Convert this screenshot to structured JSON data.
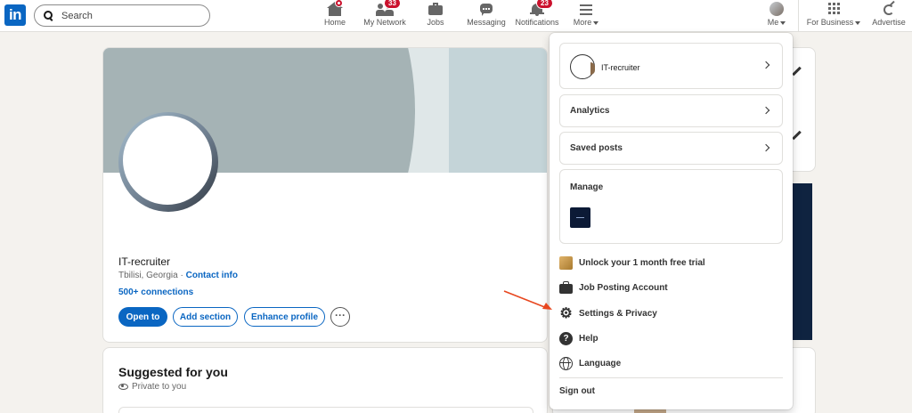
{
  "nav": {
    "logo": "in",
    "search_placeholder": "Search",
    "items": [
      {
        "label": "Home",
        "icon": "home-icon"
      },
      {
        "label": "My Network",
        "icon": "network-icon",
        "badge": "33"
      },
      {
        "label": "Jobs",
        "icon": "jobs-icon"
      },
      {
        "label": "Messaging",
        "icon": "messaging-icon"
      },
      {
        "label": "Notifications",
        "icon": "bell-icon",
        "badge": "23"
      },
      {
        "label": "More",
        "icon": "menu-icon"
      },
      {
        "label": "Me",
        "icon": "avatar"
      },
      {
        "label": "For Business",
        "icon": "grid-icon"
      },
      {
        "label": "Advertise",
        "icon": "advertise-icon"
      }
    ]
  },
  "profile": {
    "name": "IT-recruiter",
    "location": "Tbilisi, Georgia",
    "separator": "·",
    "contact_info": "Contact info",
    "connections": "500+ connections",
    "buttons": {
      "open_to": "Open to",
      "add_section": "Add section",
      "enhance_profile": "Enhance profile",
      "more": "···"
    }
  },
  "suggested": {
    "title": "Suggested for you",
    "privacy": "Private to you"
  },
  "dropdown": {
    "profile_name": "IT-recruiter",
    "analytics": "Analytics",
    "saved_posts": "Saved posts",
    "manage": "Manage",
    "items": [
      {
        "label": "Unlock your 1 month free trial",
        "icon": "premium-icon"
      },
      {
        "label": "Job Posting Account",
        "icon": "briefcase-icon"
      },
      {
        "label": "Settings & Privacy",
        "icon": "gear-icon"
      },
      {
        "label": "Help",
        "icon": "help-icon"
      },
      {
        "label": "Language",
        "icon": "globe-icon"
      }
    ],
    "help_glyph": "?",
    "gear_glyph": "⚙",
    "sign_out": "Sign out"
  },
  "colors": {
    "brand": "#0a66c2",
    "badge": "#cb112d",
    "annotation_arrow": "#e8471f"
  }
}
